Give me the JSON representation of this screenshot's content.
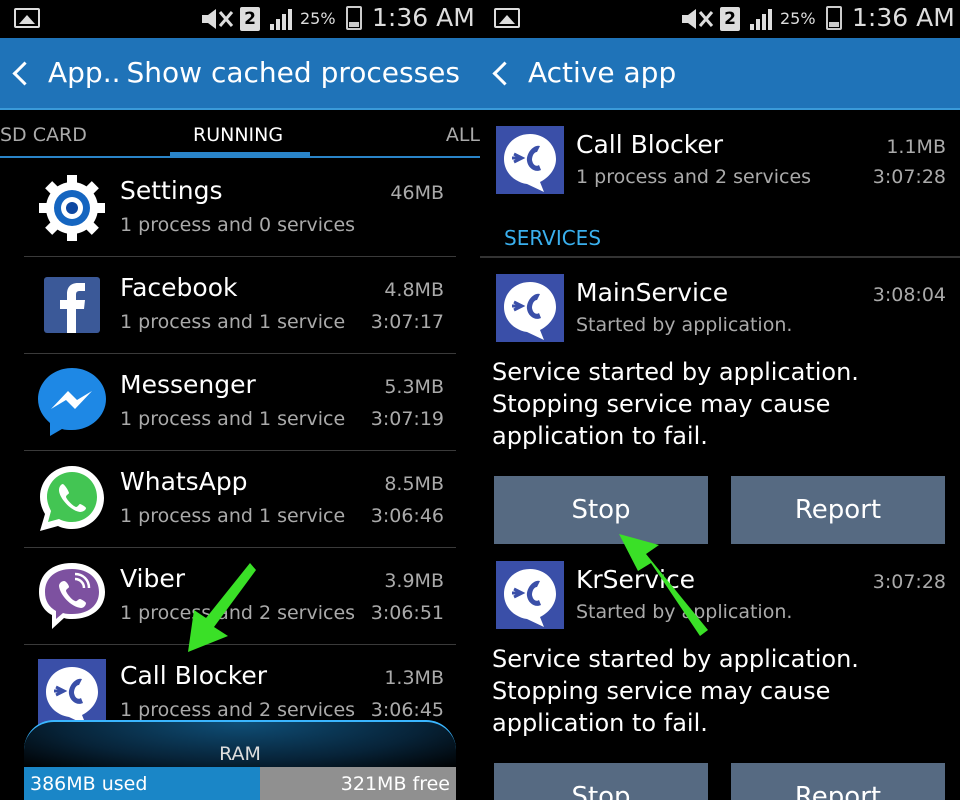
{
  "status_bar": {
    "battery_percent": "25%",
    "time": "1:36 AM",
    "sim": "2"
  },
  "left_screen": {
    "back_title": "App..",
    "action": "Show cached processes",
    "tabs": {
      "sd_card": "SD CARD",
      "running": "RUNNING",
      "all": "ALL"
    },
    "processes": [
      {
        "name": "Settings",
        "detail": "1 process and 0 services",
        "size": "46MB",
        "time": "",
        "icon": "settings-icon"
      },
      {
        "name": "Facebook",
        "detail": "1 process and 1 service",
        "size": "4.8MB",
        "time": "3:07:17",
        "icon": "facebook-icon"
      },
      {
        "name": "Messenger",
        "detail": "1 process and 1 service",
        "size": "5.3MB",
        "time": "3:07:19",
        "icon": "messenger-icon"
      },
      {
        "name": "WhatsApp",
        "detail": "1 process and 1 service",
        "size": "8.5MB",
        "time": "3:06:46",
        "icon": "whatsapp-icon"
      },
      {
        "name": "Viber",
        "detail": "1 process and 2 services",
        "size": "3.9MB",
        "time": "3:06:51",
        "icon": "viber-icon"
      },
      {
        "name": "Call Blocker",
        "detail": "1 process and 2 services",
        "size": "1.3MB",
        "time": "3:06:45",
        "icon": "call-blocker-icon"
      }
    ],
    "ram": {
      "label": "RAM",
      "used": "386MB used",
      "free": "321MB free",
      "used_fraction": 0.546
    }
  },
  "right_screen": {
    "title": "Active app",
    "app": {
      "name": "Call Blocker",
      "detail": "1 process and 2 services",
      "size": "1.1MB",
      "time": "3:07:28"
    },
    "services_header": "SERVICES",
    "services": [
      {
        "name": "MainService",
        "started_by": "Started by application.",
        "time": "3:08:04",
        "description": "Service started by application. Stopping service may cause application to fail.",
        "stop_label": "Stop",
        "report_label": "Report"
      },
      {
        "name": "KrService",
        "started_by": "Started by application.",
        "time": "3:07:28",
        "description": "Service started by application. Stopping service may cause application to fail.",
        "stop_label": "Stop",
        "report_label": "Report"
      }
    ]
  },
  "colors": {
    "action_bar": "#1f73b8",
    "accent": "#2a84c8",
    "button": "#566a82",
    "annotation_arrow": "#3ae027"
  }
}
